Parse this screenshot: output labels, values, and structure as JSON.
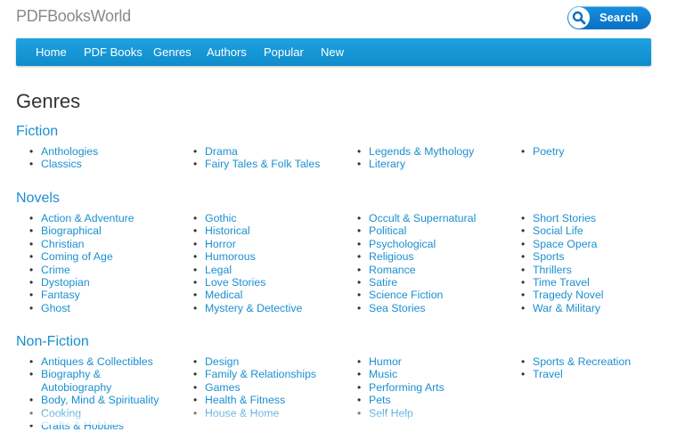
{
  "header": {
    "logo_text": "PDFBooksWorld",
    "search_label": "Search"
  },
  "nav": {
    "items": [
      "Home",
      "PDF Books",
      "Genres",
      "Authors",
      "Popular",
      "New"
    ]
  },
  "page": {
    "title": "Genres"
  },
  "sections": {
    "fiction": {
      "title": "Fiction",
      "columns": [
        [
          "Anthologies",
          "Classics"
        ],
        [
          "Drama",
          "Fairy Tales & Folk Tales"
        ],
        [
          "Legends & Mythology",
          "Literary"
        ],
        [
          "Poetry"
        ]
      ]
    },
    "novels": {
      "title": "Novels",
      "columns": [
        [
          "Action & Adventure",
          "Biographical",
          "Christian",
          "Coming of Age",
          "Crime",
          "Dystopian",
          "Fantasy",
          "Ghost"
        ],
        [
          "Gothic",
          "Historical",
          "Horror",
          "Humorous",
          "Legal",
          "Love Stories",
          "Medical",
          "Mystery & Detective"
        ],
        [
          "Occult & Supernatural",
          "Political",
          "Psychological",
          "Religious",
          "Romance",
          "Satire",
          "Science Fiction",
          "Sea Stories"
        ],
        [
          "Short Stories",
          "Social Life",
          "Space Opera",
          "Sports",
          "Thrillers",
          "Time Travel",
          "Tragedy Novel",
          "War & Military"
        ]
      ]
    },
    "nonfiction": {
      "title": "Non-Fiction",
      "columns": [
        [
          "Antiques & Collectibles",
          "Biography & Autobiography",
          "Body, Mind & Spirituality",
          "Cooking",
          "Crafts & Hobbies"
        ],
        [
          "Design",
          "Family & Relationships",
          "Games",
          "Health & Fitness",
          "House & Home"
        ],
        [
          "Humor",
          "Music",
          "Performing Arts",
          "Pets",
          "Self Help"
        ],
        [
          "Sports & Recreation",
          "Travel"
        ]
      ]
    }
  },
  "colors": {
    "link": "#1a8fd0",
    "nav_bg": "#1597d6",
    "search_bg": "#0f7ccf"
  }
}
